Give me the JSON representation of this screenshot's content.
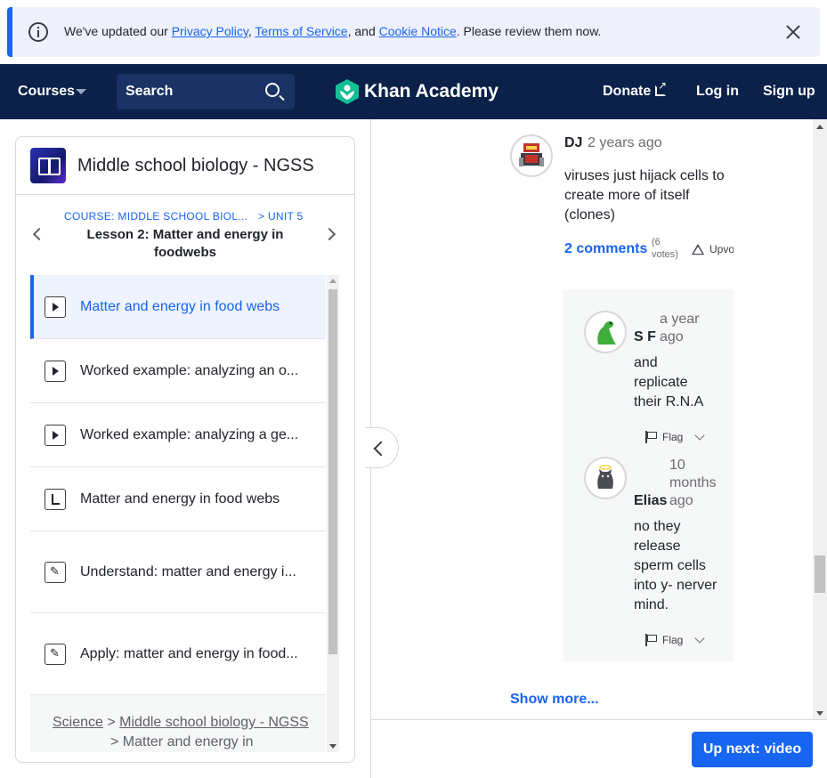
{
  "notice": {
    "prefix": "We've updated our ",
    "privacy": "Privacy Policy",
    "sep1": ", ",
    "terms": "Terms of Service",
    "sep2": ", and ",
    "cookie": "Cookie Notice",
    "suffix": ". Please review them now."
  },
  "nav": {
    "courses": "Courses",
    "search_label": "Search",
    "logo": "Khan Academy",
    "donate": "Donate",
    "login": "Log in",
    "signup": "Sign up"
  },
  "sidebar": {
    "course_title": "Middle school biology - NGSS",
    "crumb_course": "COURSE: MIDDLE SCHOOL BIOL...",
    "crumb_unit": "> UNIT 5",
    "lesson_title": "Lesson 2: Matter and energy in foodwebs",
    "items": [
      {
        "label": "Matter and energy in food webs",
        "icon": "play-icon"
      },
      {
        "label": "Worked example: analyzing an o...",
        "icon": "play-icon"
      },
      {
        "label": "Worked example: analyzing a ge...",
        "icon": "play-icon"
      },
      {
        "label": "Matter and energy in food webs",
        "icon": "article-icon"
      },
      {
        "label": "Understand: matter and energy i...",
        "icon": "pencil-icon"
      },
      {
        "label": "Apply: matter and energy in food...",
        "icon": "pencil-icon"
      }
    ],
    "bottom_crumb": {
      "science": "Science",
      "sep": " > ",
      "course": "Middle school biology - NGSS",
      "next": "> Matter and energy in"
    }
  },
  "comment": {
    "author": "DJ",
    "time": "2 years ago",
    "text": "viruses just hijack cells to create more of itself (clones)",
    "comments_link": "2 comments",
    "votes": "(6 votes)",
    "upvote": "Upvote"
  },
  "replies": [
    {
      "author": "S F",
      "time": "a year ago",
      "text": "and replicate their R.N.A",
      "flag": "Flag"
    },
    {
      "author": "Elias",
      "time": "10 months ago",
      "text": "no they release sperm cells into y- nerver mind.",
      "flag": "Flag"
    }
  ],
  "show_more": "Show more...",
  "up_next": "Up next: video",
  "colors": {
    "accent": "#1865f2",
    "nav_bg": "#0b2149",
    "logo_green": "#14bf96"
  }
}
